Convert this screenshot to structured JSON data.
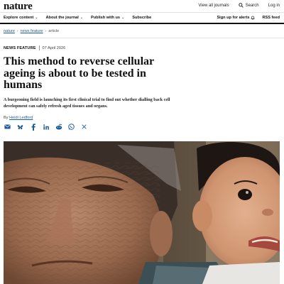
{
  "header": {
    "logo": "nature",
    "view_journals": "View all journals",
    "search": "Search",
    "login": "Log in"
  },
  "nav": {
    "explore": "Explore content",
    "about": "About the journal",
    "publish": "Publish with us",
    "subscribe": "Subscribe",
    "alerts": "Sign up for alerts",
    "rss": "RSS feed"
  },
  "breadcrumb": [
    "nature",
    "news feature",
    "article"
  ],
  "article": {
    "type": "NEWS FEATURE",
    "date": "07 April 2026",
    "title": "This method to reverse cellular ageing is about to be tested in humans",
    "dek": "A burgeoning field is launching its first clinical trial to find out whether dialling back cell development can safely refresh aged tissues and organs.",
    "byline_prefix": "By",
    "author": "Heidi Ledford"
  },
  "share_icons": [
    "email-icon",
    "bluesky-icon",
    "facebook-icon",
    "linkedin-icon",
    "reddit-icon",
    "whatsapp-icon",
    "x-icon"
  ],
  "colors": {
    "link": "#1f5c9c",
    "text": "#111111",
    "rule": "#111111"
  }
}
